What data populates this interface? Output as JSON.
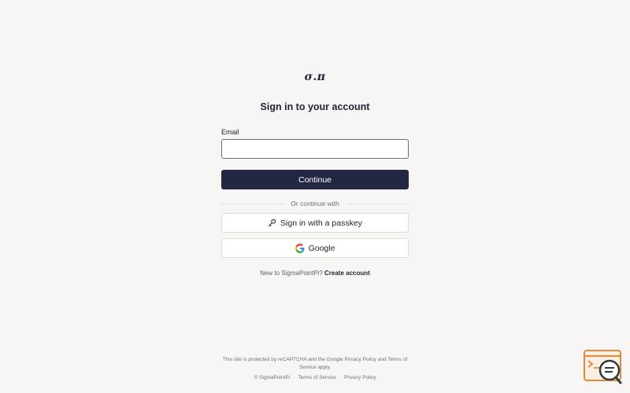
{
  "brand": {
    "logo_text": "σ.π"
  },
  "login": {
    "heading": "Sign in to your account",
    "email_label": "Email",
    "email_value": "",
    "email_placeholder": "",
    "continue_label": "Continue",
    "divider_text": "Or continue with",
    "passkey_label": "Sign in with a passkey",
    "google_label": "Google",
    "signup_prompt": "New to SigmaPointPi?",
    "signup_link": "Create account"
  },
  "footer": {
    "recaptcha_prefix": "This site is protected by reCAPTCHA and the Google",
    "privacy_link": "Privacy Policy",
    "and_text": "and",
    "terms_link": "Terms of Service",
    "apply_text": "apply.",
    "copyright": "© SigmaPointPi",
    "terms_of_service": "Terms of Service",
    "privacy_policy": "Privacy Policy",
    "separator": "·"
  },
  "icons": {
    "passkey": "key-icon",
    "google": "google-icon",
    "help": "help-chat-icon"
  },
  "colors": {
    "background": "#f7f6f5",
    "primary_button": "#232741",
    "help_widget": "#e8883a"
  }
}
